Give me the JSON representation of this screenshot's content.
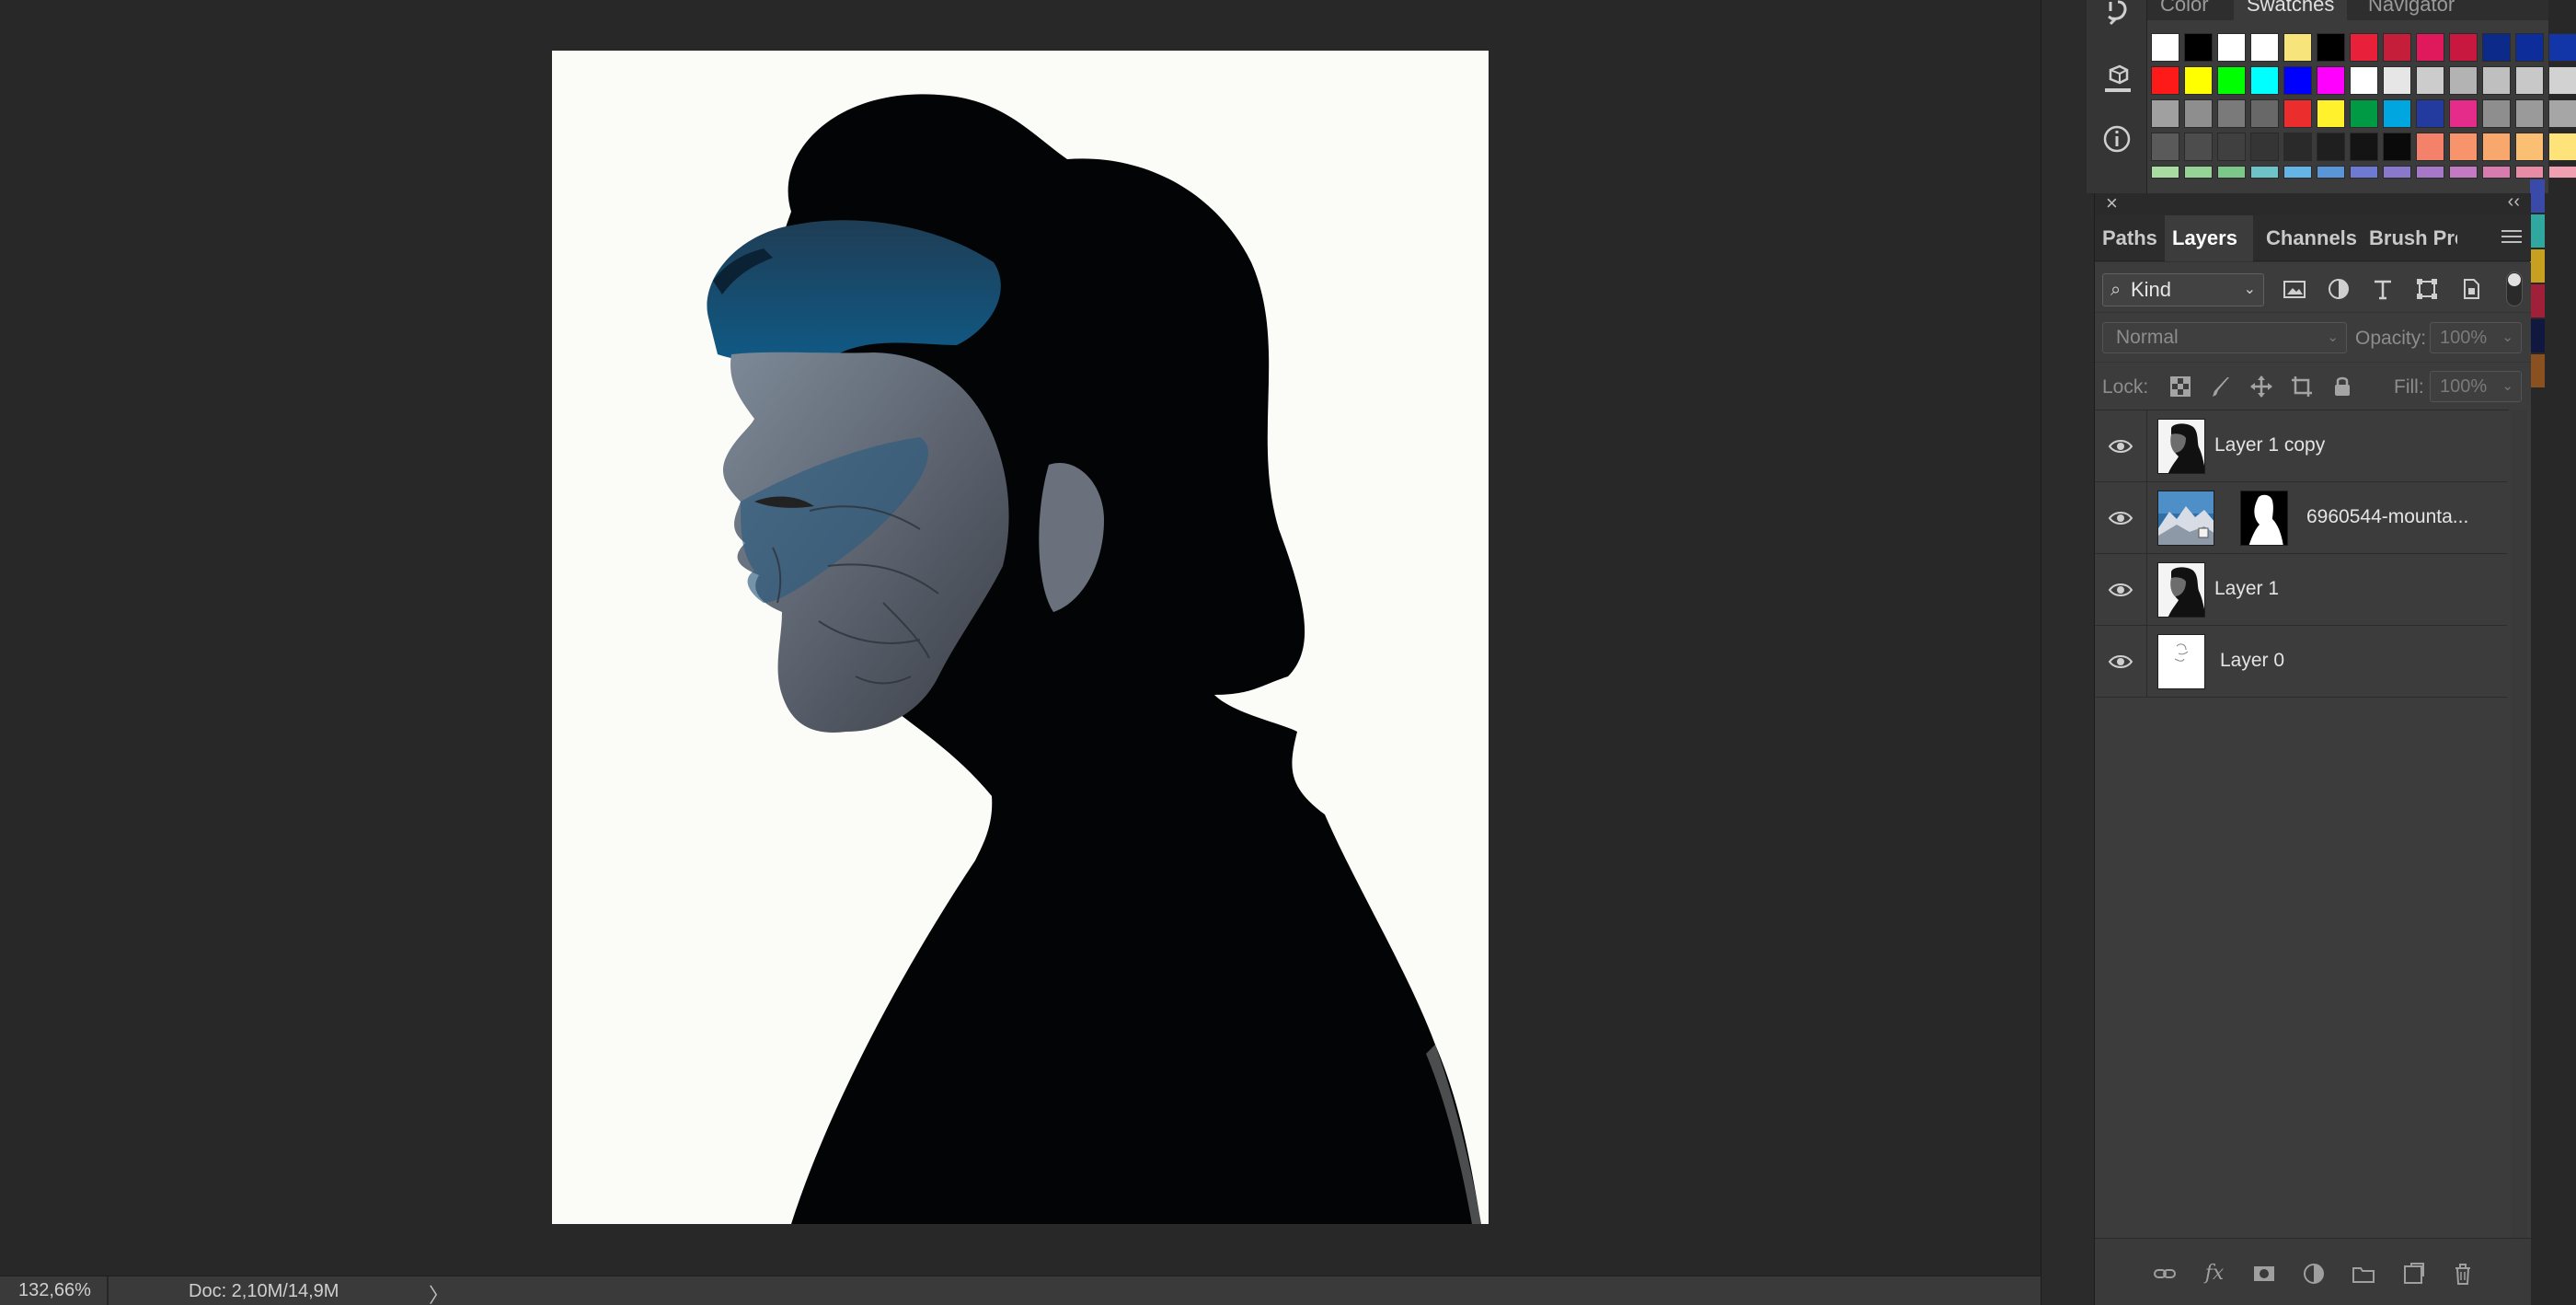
{
  "status_bar": {
    "zoom": "132,66%",
    "doc_size": "Doc: 2,10M/14,9M",
    "arrow": "〉"
  },
  "swatches_panel": {
    "tabs": [
      {
        "label": "Color"
      },
      {
        "label": "Swatches",
        "active": true
      },
      {
        "label": "Navigator"
      }
    ],
    "rows": [
      [
        "#ffffff",
        "#000000",
        "#ffffff",
        "#ffffff",
        "#f7e47a",
        "#000000",
        "#e8203a",
        "#c41e3a",
        "#e0195d",
        "#c8183f",
        "#0b2a8a",
        "#0c2d9a",
        "#1235a8"
      ],
      [
        "#ff1a1a",
        "#ffff00",
        "#00ff00",
        "#00ffff",
        "#0000ff",
        "#ff00ff",
        "#ffffff",
        "#e6e6e6",
        "#cccccc",
        "#b3b3b3",
        "#bfbfbf",
        "#c8c8c8",
        "#d2d2d2"
      ],
      [
        "#a0a0a0",
        "#8e8e8e",
        "#7a7a7a",
        "#686868",
        "#ec2d2d",
        "#fff22d",
        "#009a44",
        "#00a6e0",
        "#233a9e",
        "#e62c8a",
        "#8e8e8e",
        "#9a9a9a",
        "#a6a6a6"
      ],
      [
        "#5a5a5a",
        "#4d4d4d",
        "#404040",
        "#353535",
        "#2a2a2a",
        "#1f1f1f",
        "#141414",
        "#0a0a0a",
        "#f4826b",
        "#f7946c",
        "#f9a86d",
        "#fbbf74",
        "#fde37a"
      ],
      [
        "#a8dca0",
        "#96d396",
        "#7cc88a",
        "#6ec3c8",
        "#64b5e6",
        "#5a95d8",
        "#6e7ad2",
        "#8a78cc",
        "#a878c8",
        "#c47ac2",
        "#d87cb0",
        "#e88ca6",
        "#f0a0b0"
      ]
    ],
    "right_strip": [
      "#3a4aa8",
      "#30a8a0",
      "#c8a020",
      "#a0203a",
      "#101840",
      "#8a5020"
    ]
  },
  "layers_panel": {
    "tabs": [
      {
        "label": "Paths"
      },
      {
        "label": "Layers",
        "active": true
      },
      {
        "label": "Channels"
      },
      {
        "label": "Brush Pre"
      }
    ],
    "filter": {
      "kind": "Kind"
    },
    "blend_mode": "Normal",
    "opacity_label": "Opacity:",
    "opacity_value": "100%",
    "lock_label": "Lock:",
    "fill_label": "Fill:",
    "fill_value": "100%",
    "layers": [
      {
        "name": "Layer 1 copy",
        "visible": true,
        "thumb": "portrait"
      },
      {
        "name": "6960544-mounta...",
        "visible": true,
        "thumb": "mountain",
        "has_mask": true
      },
      {
        "name": "Layer 1",
        "visible": true,
        "thumb": "portrait"
      },
      {
        "name": "Layer 0",
        "visible": true,
        "thumb": "sketch"
      }
    ],
    "footer_icons": [
      "link-icon",
      "fx-icon",
      "mask-icon",
      "adjustment-icon",
      "folder-icon",
      "new-layer-icon",
      "trash-icon"
    ]
  }
}
